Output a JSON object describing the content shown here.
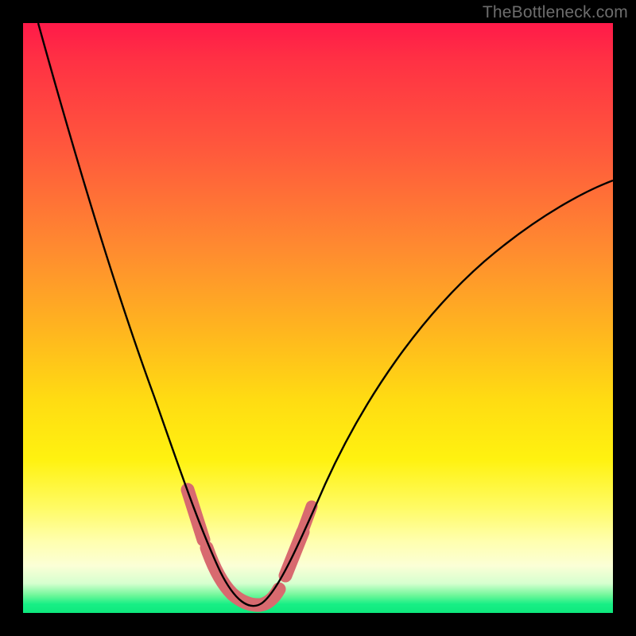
{
  "watermark": "TheBottleneck.com",
  "colors": {
    "background": "#000000",
    "gradient_top": "#ff1a49",
    "gradient_mid1": "#ff8a30",
    "gradient_mid2": "#fff210",
    "gradient_bottom": "#0ee87d",
    "curve": "#000000",
    "highlight": "#d86a6f"
  },
  "chart_data": {
    "type": "line",
    "title": "",
    "xlabel": "",
    "ylabel": "",
    "xlim": [
      0,
      100
    ],
    "ylim": [
      0,
      100
    ],
    "series": [
      {
        "name": "bottleneck-curve",
        "x": [
          3,
          5,
          8,
          12,
          16,
          20,
          24,
          27,
          29,
          31,
          33,
          35,
          37,
          39,
          41,
          43,
          46,
          50,
          55,
          60,
          66,
          72,
          78,
          85,
          92,
          100
        ],
        "y": [
          100,
          90,
          78,
          64,
          50,
          38,
          27,
          19,
          13,
          8,
          4,
          2,
          1,
          1,
          2,
          4,
          8,
          14,
          21,
          28,
          35,
          42,
          49,
          56,
          62,
          68
        ]
      }
    ],
    "annotations": {
      "highlight_segments": [
        {
          "x_range": [
            27.5,
            32.5
          ],
          "side": "left-descent"
        },
        {
          "x_range": [
            32.5,
            42.5
          ],
          "side": "trough"
        },
        {
          "x_range": [
            42.5,
            47.0
          ],
          "side": "right-ascent"
        }
      ]
    }
  }
}
